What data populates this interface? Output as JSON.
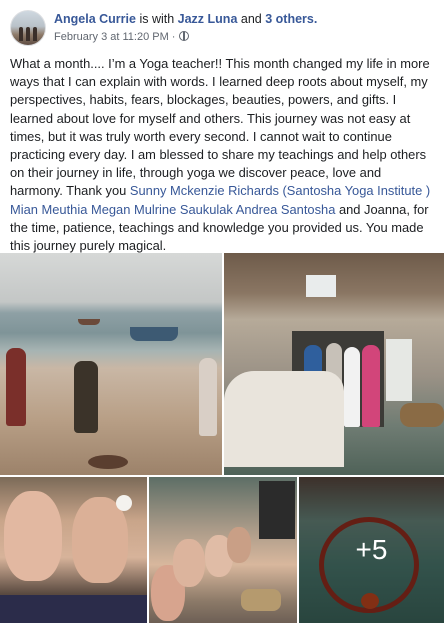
{
  "post": {
    "author": "Angela Currie",
    "with_text": " is with ",
    "tagged": "Jazz Luna",
    "and_text": " and ",
    "others": "3 others.",
    "date": "February 3 at 11:20 PM",
    "separator": " · ",
    "privacy_icon": "globe-icon",
    "menu_icon": "chevron-down-icon",
    "body": {
      "t1": "What a month.... I’m a Yoga teacher!! This month changed my life in more ways that I can explain with words. I learned deep roots about myself, my perspectives, habits, fears, blockages, beauties, powers, and gifts. I learned about love for myself and others. This journey was not easy at times, but it was truly worth every second. I cannot wait to continue practicing every day. I am blessed to share my teachings and help others on their journey in life, through yoga we discover peace, love and harmony. Thank you ",
      "tag1": "Sunny Mckenzie Richards (Santosha Yoga Institute )",
      "sp1": " ",
      "tag2": "Mian Meuthia",
      "sp2": " ",
      "tag3": "Megan Mulrine",
      "sp3": " ",
      "tag4": "Saukulak Andrea Santosha",
      "t2": " and Joanna, for the time, patience, teachings and knowledge you provided us. You made this journey purely magical."
    }
  },
  "photos": {
    "more_count": "+5"
  }
}
